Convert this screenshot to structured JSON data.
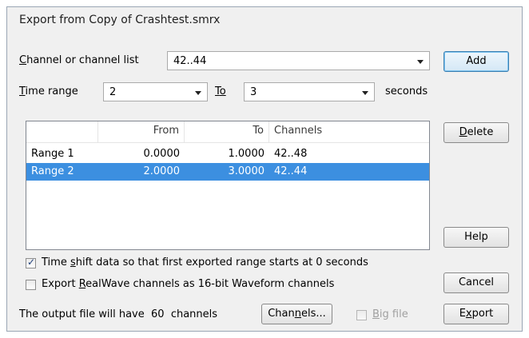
{
  "window": {
    "title": "Export from Copy of Crashtest.smrx"
  },
  "channel": {
    "label_accel": "C",
    "label_rest": "hannel or channel list",
    "value": "42..44"
  },
  "time_range": {
    "label_accel": "T",
    "label_rest": "ime range",
    "from_value": "2",
    "to_label_pre": "T",
    "to_label_accel": "o",
    "to_value": "3",
    "units": "seconds"
  },
  "buttons": {
    "add": "Add",
    "delete_accel": "D",
    "delete_rest": "elete",
    "help": "Help",
    "cancel": "Cancel",
    "export_pre": "E",
    "export_accel": "x",
    "export_rest": "port",
    "channels_pre": "Chan",
    "channels_accel": "n",
    "channels_rest": "els..."
  },
  "range_table": {
    "columns": [
      "",
      "From",
      "To",
      "Channels"
    ],
    "rows": [
      {
        "name": "Range 1",
        "from": "0.0000",
        "to": "1.0000",
        "channels": "42..48",
        "selected": false
      },
      {
        "name": "Range 2",
        "from": "2.0000",
        "to": "3.0000",
        "channels": "42..44",
        "selected": true
      }
    ]
  },
  "options": {
    "time_shift": {
      "pre": "Time ",
      "accel": "s",
      "rest": "hift data so that first exported range starts at 0 seconds",
      "checked": true
    },
    "realwave": {
      "pre": "Export ",
      "accel": "R",
      "rest": "ealWave channels as 16-bit Waveform channels",
      "checked": false
    },
    "big_file": {
      "accel": "B",
      "rest": "ig file",
      "checked": false,
      "enabled": false
    }
  },
  "output": {
    "prefix": "The output file will have",
    "count": "60",
    "suffix": "channels"
  }
}
